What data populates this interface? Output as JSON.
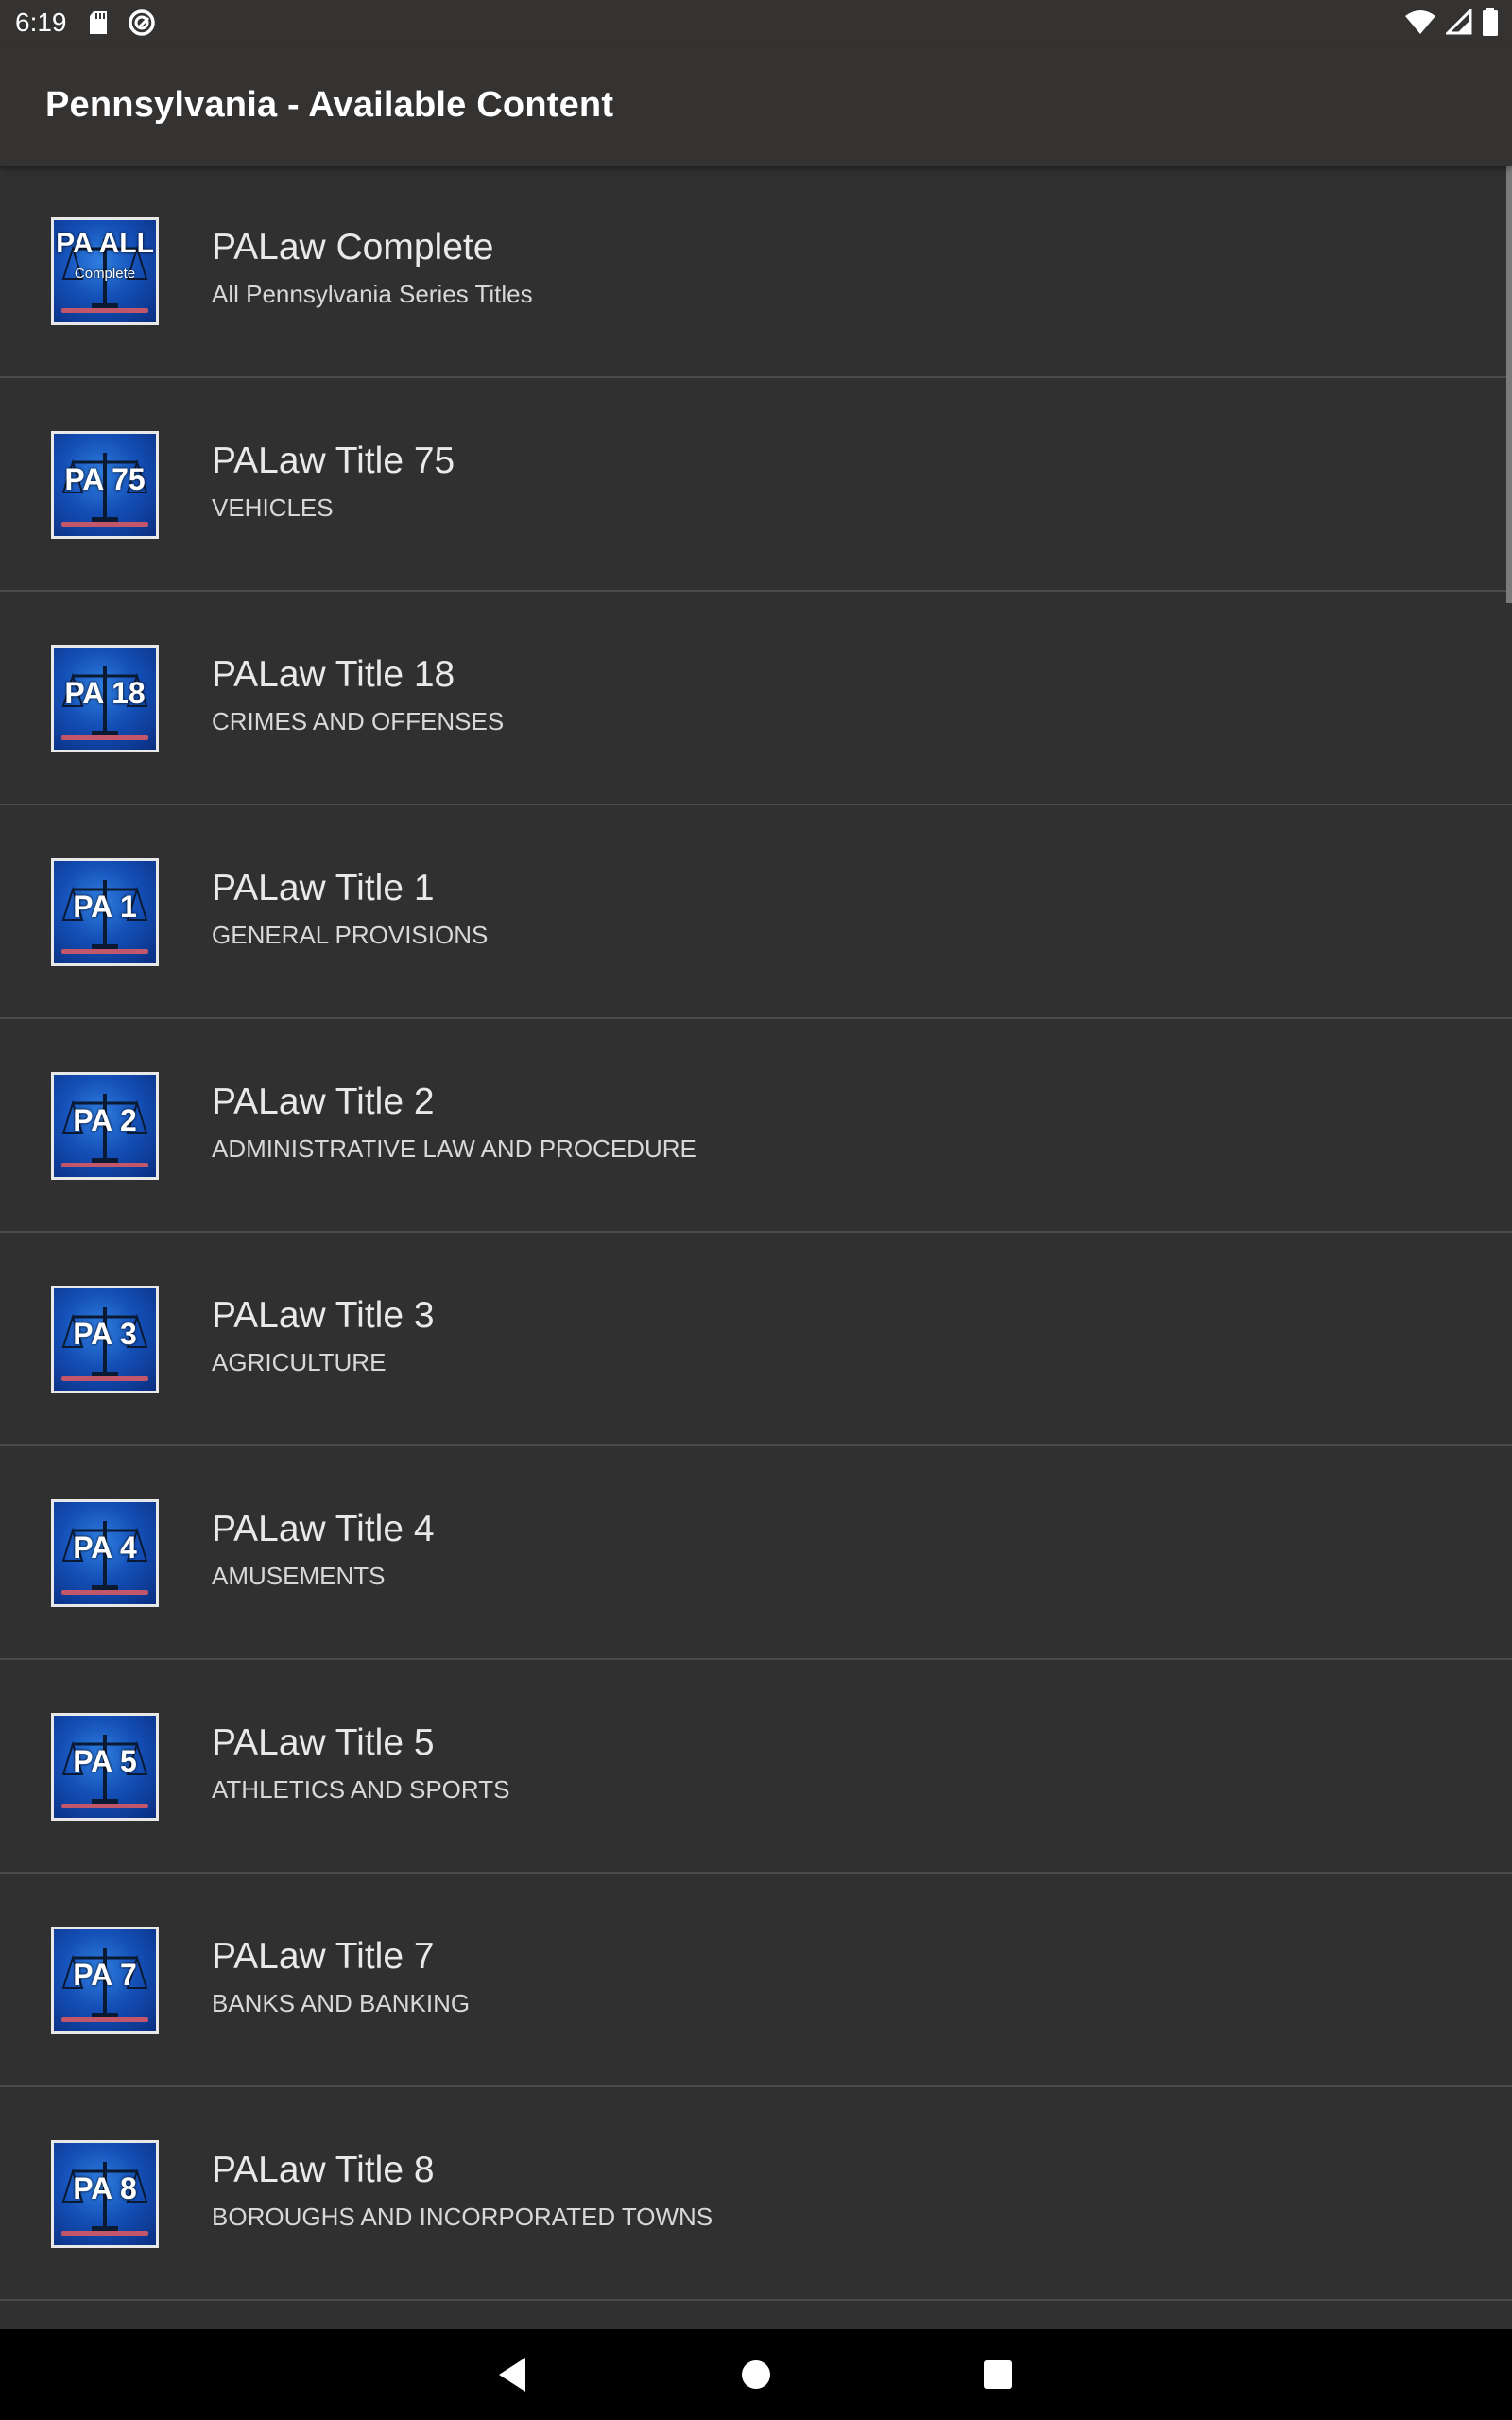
{
  "status_bar": {
    "time": "6:19",
    "left_icons": [
      "sd-card-icon",
      "sync-icon"
    ],
    "right_icons": [
      "wifi-icon",
      "cell-signal-icon",
      "battery-icon"
    ]
  },
  "app_bar": {
    "title": "Pennsylvania - Available Content"
  },
  "items": [
    {
      "thumb": "PA ALL",
      "thumb_sub": "Complete",
      "title": "PALaw Complete",
      "subtitle": "All Pennsylvania Series Titles"
    },
    {
      "thumb": "PA 75",
      "title": "PALaw Title 75",
      "subtitle": "VEHICLES"
    },
    {
      "thumb": "PA 18",
      "title": "PALaw Title 18",
      "subtitle": "CRIMES AND OFFENSES"
    },
    {
      "thumb": "PA 1",
      "title": "PALaw Title 1",
      "subtitle": "GENERAL PROVISIONS"
    },
    {
      "thumb": "PA 2",
      "title": "PALaw Title 2",
      "subtitle": "ADMINISTRATIVE LAW AND PROCEDURE"
    },
    {
      "thumb": "PA 3",
      "title": "PALaw Title 3",
      "subtitle": "AGRICULTURE"
    },
    {
      "thumb": "PA 4",
      "title": "PALaw Title 4",
      "subtitle": "AMUSEMENTS"
    },
    {
      "thumb": "PA 5",
      "title": "PALaw Title 5",
      "subtitle": "ATHLETICS AND SPORTS"
    },
    {
      "thumb": "PA 7",
      "title": "PALaw Title 7",
      "subtitle": "BANKS AND BANKING"
    },
    {
      "thumb": "PA 8",
      "title": "PALaw Title 8",
      "subtitle": "BOROUGHS AND INCORPORATED TOWNS"
    }
  ],
  "nav_bar": {
    "buttons": [
      "back-icon",
      "home-icon",
      "recents-icon"
    ]
  },
  "colors": {
    "background": "#303030",
    "app_bar": "#353331",
    "thumb_blue": "#1450b8",
    "divider": "#4a4a4a"
  }
}
